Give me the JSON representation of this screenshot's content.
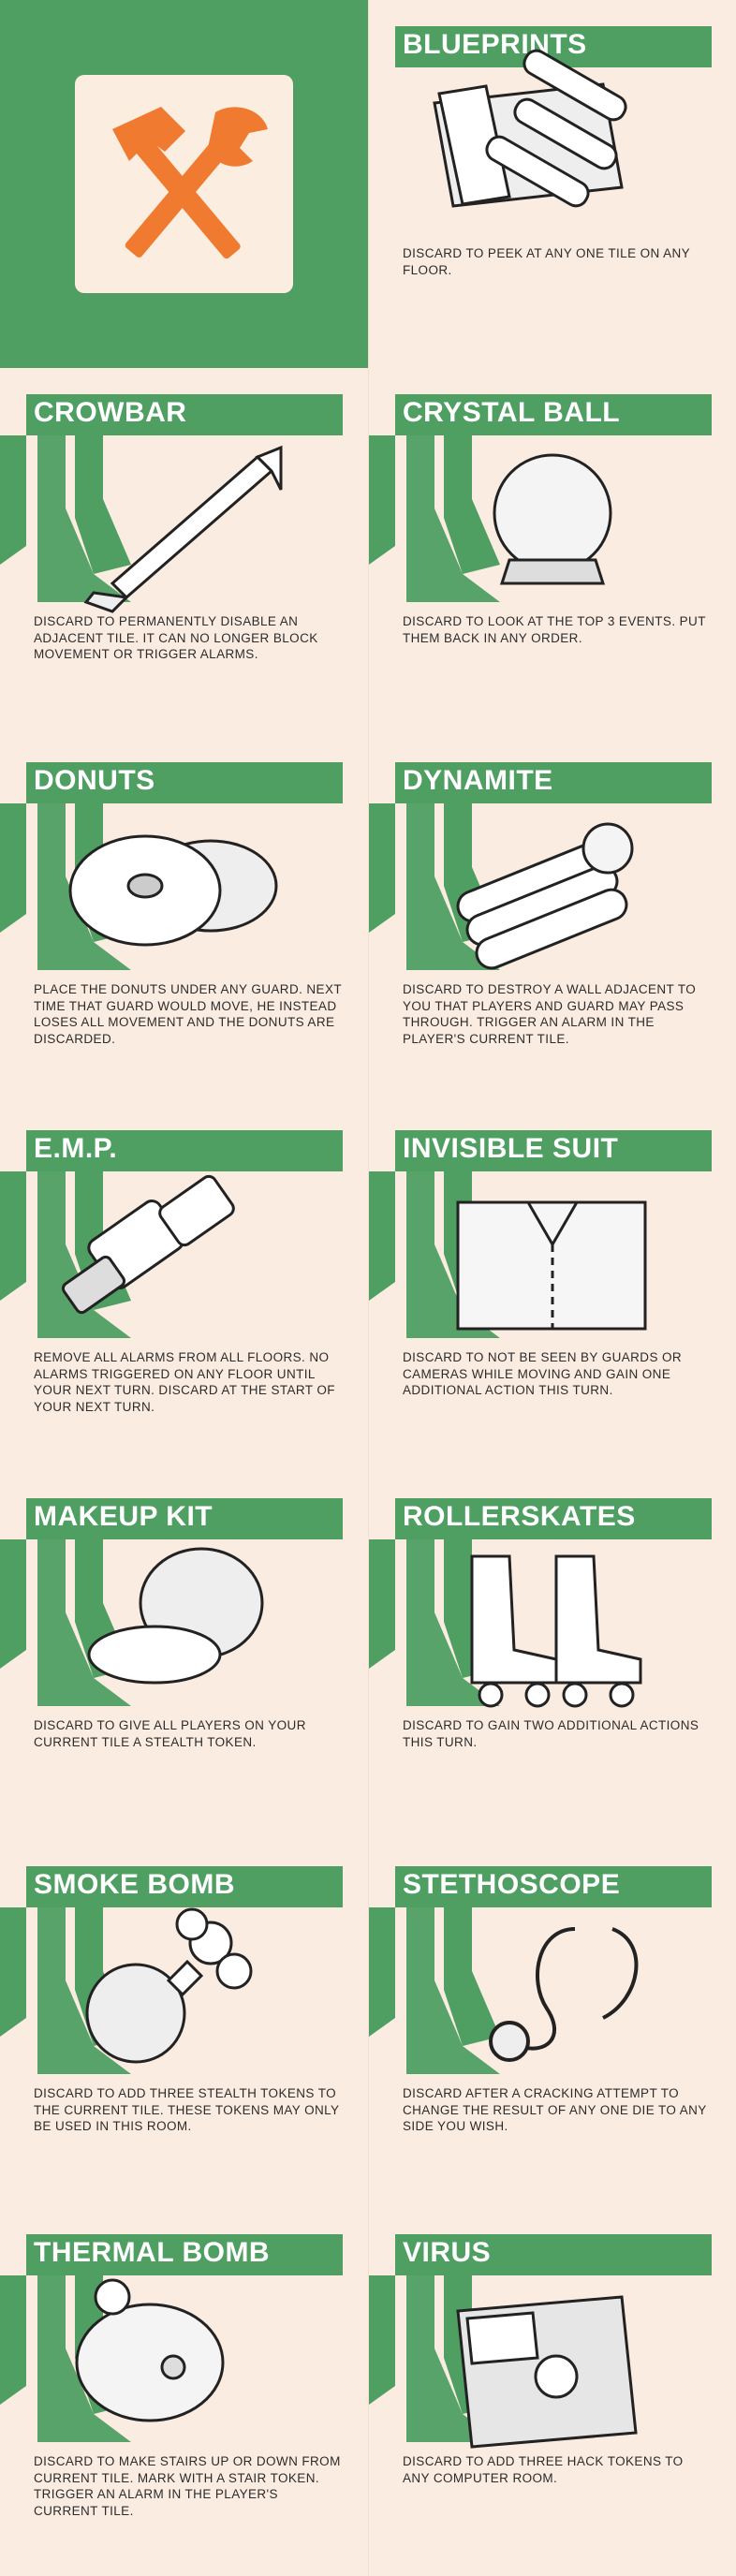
{
  "cover": {
    "icon": "hammer-wrench-icon",
    "accent": "#4f9f63",
    "icon_color": "#f07a2f"
  },
  "cards": [
    {
      "title": "BLUEPRINTS",
      "icon": "blueprints-icon",
      "desc": "DISCARD TO PEEK AT ANY ONE TILE ON ANY FLOOR."
    },
    {
      "title": "CROWBAR",
      "icon": "crowbar-icon",
      "desc": "DISCARD TO PERMANENTLY DISABLE AN ADJACENT TILE. IT CAN NO LONGER BLOCK MOVEMENT OR TRIGGER ALARMS."
    },
    {
      "title": "CRYSTAL BALL",
      "icon": "crystal-ball-icon",
      "desc": "DISCARD TO LOOK AT THE TOP 3 EVENTS. PUT THEM BACK IN ANY ORDER."
    },
    {
      "title": "DONUTS",
      "icon": "donuts-icon",
      "desc": "PLACE THE DONUTS UNDER ANY GUARD. NEXT TIME THAT GUARD WOULD MOVE, HE INSTEAD LOSES ALL MOVEMENT AND THE DONUTS ARE DISCARDED."
    },
    {
      "title": "DYNAMITE",
      "icon": "dynamite-icon",
      "desc": "DISCARD TO DESTROY A WALL ADJACENT TO YOU THAT PLAYERS AND GUARD MAY PASS THROUGH. TRIGGER AN ALARM IN THE PLAYER'S CURRENT TILE."
    },
    {
      "title": "E.M.P.",
      "icon": "emp-icon",
      "desc": "REMOVE ALL ALARMS FROM ALL FLOORS. NO ALARMS TRIGGERED ON ANY FLOOR UNTIL YOUR NEXT TURN. DISCARD AT THE START OF YOUR NEXT TURN."
    },
    {
      "title": "INVISIBLE SUIT",
      "icon": "invisible-suit-icon",
      "desc": "DISCARD TO NOT BE SEEN BY GUARDS OR CAMERAS WHILE MOVING AND GAIN ONE ADDITIONAL ACTION THIS TURN."
    },
    {
      "title": "MAKEUP KIT",
      "icon": "makeup-kit-icon",
      "desc": "DISCARD TO GIVE ALL PLAYERS ON YOUR CURRENT TILE A STEALTH TOKEN."
    },
    {
      "title": "ROLLERSKATES",
      "icon": "rollerskates-icon",
      "desc": "DISCARD TO GAIN TWO ADDITIONAL ACTIONS THIS TURN."
    },
    {
      "title": "SMOKE BOMB",
      "icon": "smoke-bomb-icon",
      "desc": "DISCARD TO ADD THREE STEALTH TOKENS TO THE CURRENT TILE. THESE TOKENS MAY ONLY BE USED IN THIS ROOM."
    },
    {
      "title": "STETHOSCOPE",
      "icon": "stethoscope-icon",
      "desc": "DISCARD AFTER A CRACKING ATTEMPT TO CHANGE THE RESULT OF ANY ONE DIE TO ANY SIDE YOU WISH."
    },
    {
      "title": "THERMAL BOMB",
      "icon": "thermal-bomb-icon",
      "desc": "DISCARD TO MAKE STAIRS UP OR DOWN FROM CURRENT TILE. MARK WITH A STAIR TOKEN. TRIGGER AN ALARM IN THE PLAYER'S CURRENT TILE."
    },
    {
      "title": "VIRUS",
      "icon": "virus-icon",
      "desc": "DISCARD TO ADD THREE HACK TOKENS TO ANY COMPUTER ROOM."
    }
  ]
}
